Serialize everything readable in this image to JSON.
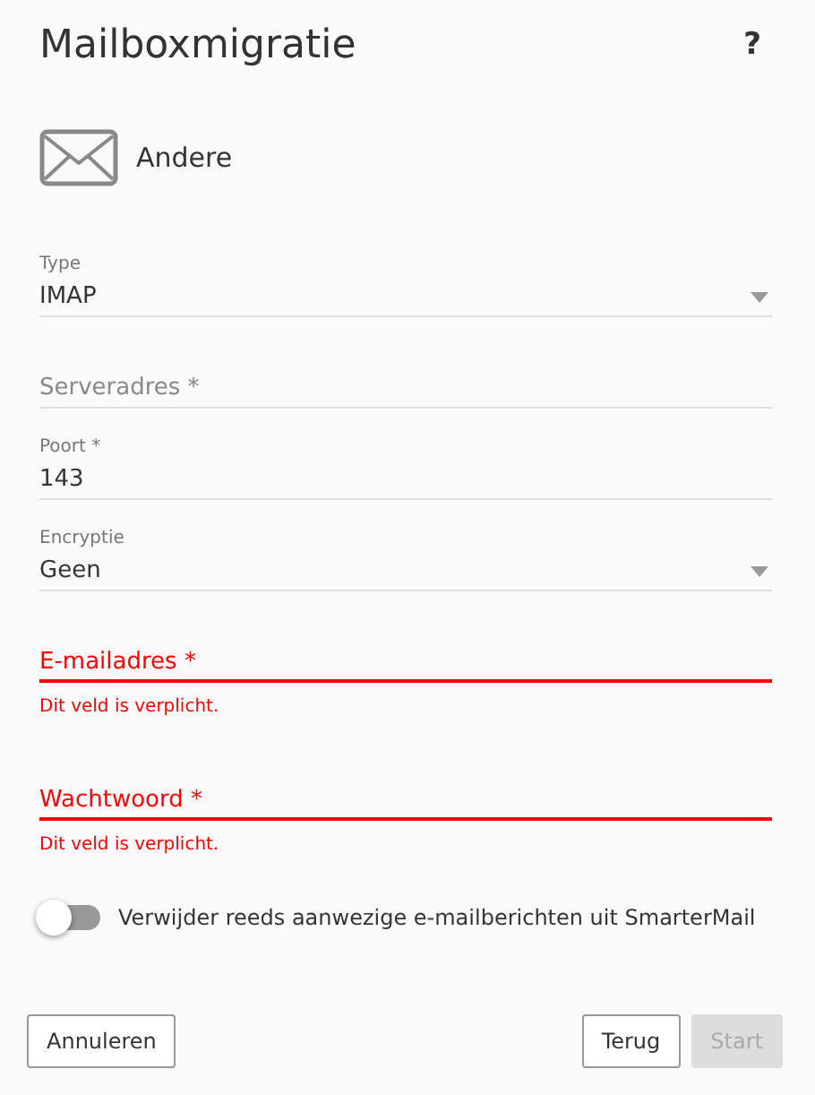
{
  "title": "Mailboxmigratie",
  "help": "?",
  "source": {
    "label": "Andere"
  },
  "fields": [
    {
      "kind": "select",
      "label": "Type",
      "value": "IMAP"
    },
    {
      "kind": "text",
      "placeholder": "Serveradres *"
    },
    {
      "kind": "text",
      "label": "Poort *",
      "value": "143"
    },
    {
      "kind": "select",
      "label": "Encryptie",
      "value": "Geen"
    },
    {
      "kind": "text",
      "placeholder": "E-mailadres *",
      "error": "Dit veld is verplicht."
    },
    {
      "kind": "text",
      "placeholder": "Wachtwoord *",
      "error": "Dit veld is verplicht."
    }
  ],
  "toggle": {
    "label": "Verwijder reeds aanwezige e-mailberichten uit SmarterMail",
    "on": false
  },
  "buttons": [
    {
      "label": "Annuleren",
      "disabled": false
    },
    {
      "label": "Terug",
      "disabled": false
    },
    {
      "label": "Start",
      "disabled": true
    }
  ]
}
